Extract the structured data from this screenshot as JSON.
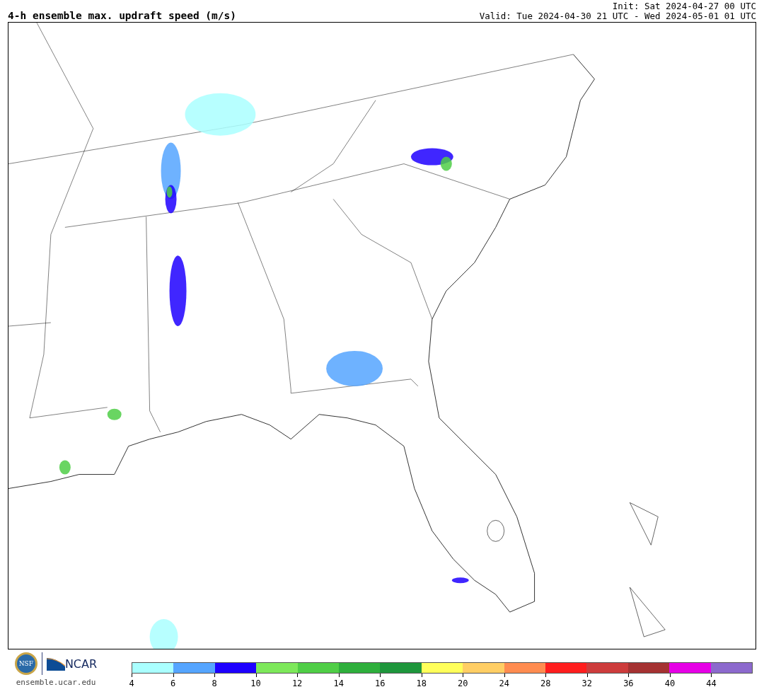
{
  "title": "4-h ensemble max. updraft speed (m/s)",
  "init": "Init: Sat 2024-04-27 00 UTC",
  "valid": "Valid: Tue 2024-04-30 21 UTC - Wed 2024-05-01 01 UTC",
  "logo": {
    "seal": "NSF",
    "name": "NCAR",
    "url": "ensemble.ucar.edu"
  },
  "colorbar": {
    "segments": [
      {
        "color": "#aaffff"
      },
      {
        "color": "#55a5ff"
      },
      {
        "color": "#1e00ff"
      },
      {
        "color": "#7de85a"
      },
      {
        "color": "#4fce46"
      },
      {
        "color": "#2eaf3c"
      },
      {
        "color": "#1e963c"
      },
      {
        "color": "#ffff5a"
      },
      {
        "color": "#ffce64"
      },
      {
        "color": "#ff8c50"
      },
      {
        "color": "#ff1e1e"
      },
      {
        "color": "#cd3c3c"
      },
      {
        "color": "#a53232"
      },
      {
        "color": "#e600e6"
      },
      {
        "color": "#8c69cd"
      }
    ],
    "ticks": [
      "4",
      "6",
      "8",
      "10",
      "12",
      "14",
      "16",
      "18",
      "20",
      "24",
      "28",
      "32",
      "36",
      "40",
      "44"
    ]
  }
}
